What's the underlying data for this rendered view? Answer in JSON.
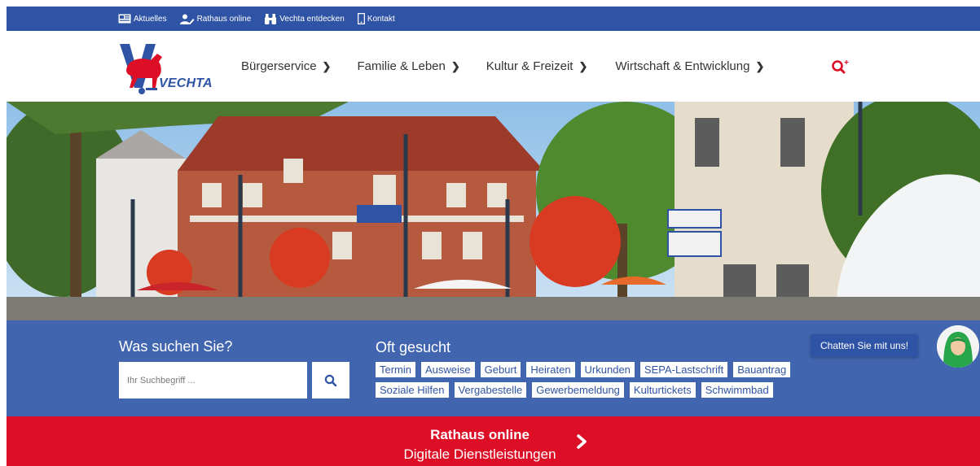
{
  "topbar": {
    "links": [
      {
        "label": "Aktuelles",
        "icon": "news-icon"
      },
      {
        "label": "Rathaus online",
        "icon": "users-icon"
      },
      {
        "label": "Vechta entdecken",
        "icon": "binoculars-icon"
      },
      {
        "label": "Kontakt",
        "icon": "phone-icon"
      }
    ]
  },
  "header": {
    "logo_text": "VECHTA",
    "nav": [
      {
        "label": "Bürgerservice"
      },
      {
        "label": "Familie & Leben"
      },
      {
        "label": "Kultur & Freizeit"
      },
      {
        "label": "Wirtschaft & Entwicklung"
      }
    ]
  },
  "search": {
    "heading": "Was suchen Sie?",
    "placeholder": "Ihr Suchbegriff ..."
  },
  "frequent": {
    "heading": "Oft gesucht",
    "row1": [
      "Termin",
      "Ausweise",
      "Geburt",
      "Heiraten",
      "Urkunden",
      "SEPA-Lastschrift",
      "Bauantrag"
    ],
    "row2": [
      "Soziale Hilfen",
      "Vergabestelle",
      "Gewerbemeldung",
      "Kulturtickets",
      "Schwimmbad"
    ]
  },
  "chat": {
    "label": "Chatten Sie mit uns!"
  },
  "banner": {
    "title": "Rathaus online",
    "subtitle": "Digitale Dienstleistungen"
  },
  "colors": {
    "primary_blue": "#2f54a5",
    "accent_red": "#dc0f26"
  }
}
